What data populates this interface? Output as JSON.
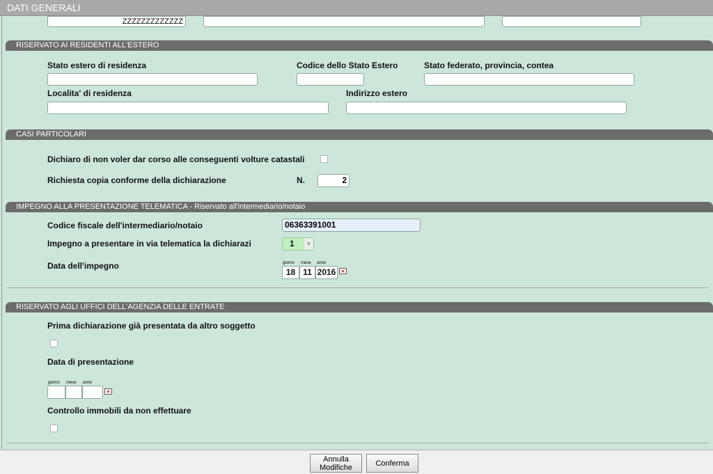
{
  "window": {
    "title": "DATI GENERALI"
  },
  "top_row": {
    "field1_value": "ZZZZZZZZZZZZZ",
    "field2_value": "",
    "field3_value": ""
  },
  "section_estero": {
    "title": "RISERVATO AI RESIDENTI ALL'ESTERO",
    "stato_estero_label": "Stato estero di residenza",
    "codice_stato_label": "Codice dello Stato Estero",
    "stato_federato_label": "Stato federato, provincia, contea",
    "localita_label": "Localita' di residenza",
    "indirizzo_label": "Indirizzo estero",
    "stato_estero_value": "",
    "codice_stato_value": "",
    "stato_federato_value": "",
    "localita_value": "",
    "indirizzo_value": ""
  },
  "section_casi": {
    "title": "CASI PARTICOLARI",
    "volture_label": "Dichiaro di non voler dar corso alle conseguenti volture catastali",
    "volture_checked": false,
    "copia_label": "Richiesta copia conforme della dichiarazione",
    "n_label": "N.",
    "copia_value": "2"
  },
  "section_impegno": {
    "title": "IMPEGNO ALLA PRESENTAZIONE TELEMATICA - Riservato all'intermediario/notaio",
    "cf_label": "Codice fiscale dell'intermediario/notaio",
    "cf_value": "06363391001",
    "impegno_label": "Impegno a presentare in via telematica la dichiarazi",
    "impegno_value": "1",
    "data_label": "Data dell'impegno",
    "date_headers": {
      "giorno": "giorno",
      "mese": "mese",
      "anno": "anno"
    },
    "giorno": "18",
    "mese": "11",
    "anno": "2016"
  },
  "section_uffici": {
    "title": "RISERVATO AGLI UFFICI DELL'AGENZIA DELLE ENTRATE",
    "prima_label": "Prima dichiarazione già presentata da altro soggetto",
    "prima_checked": false,
    "data_pres_label": "Data di presentazione",
    "date_headers": {
      "giorno": "giorno",
      "mese": "mese",
      "anno": "anno"
    },
    "giorno": "",
    "mese": "",
    "anno": "",
    "controllo_label": "Controllo immobili da non effettuare",
    "controllo_checked": false
  },
  "footer": {
    "annulla_line1": "Annulla",
    "annulla_line2": "Modifiche",
    "conferma_label": "Conferma"
  },
  "icons": {
    "calendar": "calendar-icon",
    "dropdown": "chevron-down-icon"
  },
  "colors": {
    "background": "#cde6da",
    "section_header": "#6c6c6c",
    "title_bar": "#a9a9a9",
    "select_bg": "#bff0bf"
  }
}
